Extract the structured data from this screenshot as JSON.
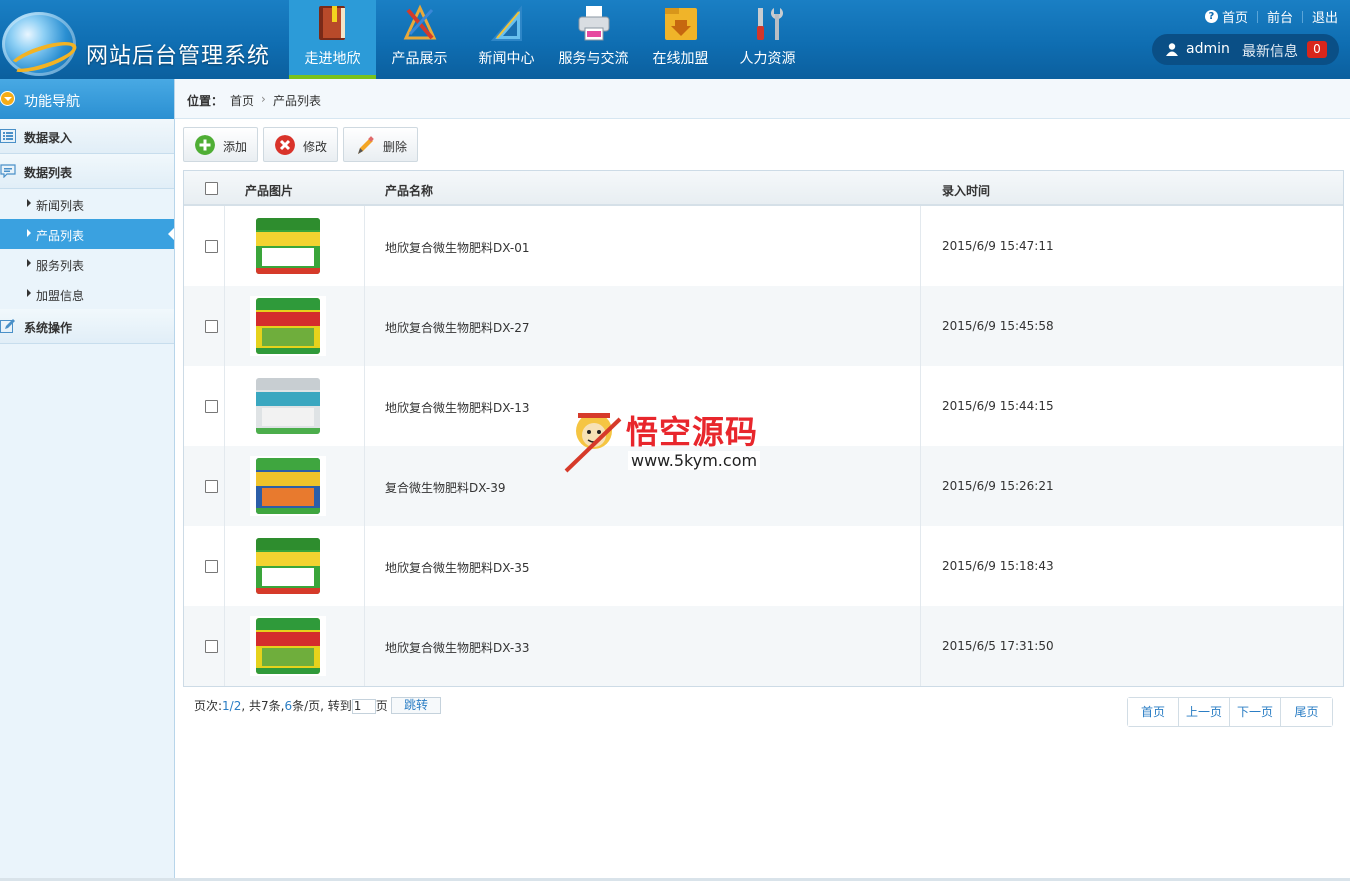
{
  "header": {
    "title": "网站后台管理系统",
    "nav": [
      {
        "label": "走进地欣",
        "icon": "book-icon",
        "active": true
      },
      {
        "label": "产品展示",
        "icon": "design-tools-icon",
        "active": false
      },
      {
        "label": "新闻中心",
        "icon": "ruler-icon",
        "active": false
      },
      {
        "label": "服务与交流",
        "icon": "printer-icon",
        "active": false
      },
      {
        "label": "在线加盟",
        "icon": "folder-download-icon",
        "active": false
      },
      {
        "label": "人力资源",
        "icon": "tools-icon",
        "active": false
      }
    ],
    "links": {
      "home": "首页",
      "front": "前台",
      "logout": "退出"
    },
    "user": {
      "name": "admin",
      "newest_label": "最新信息",
      "count": "0"
    }
  },
  "sidebar": {
    "title": "功能导航",
    "groups": [
      {
        "label": "数据录入",
        "icon": "list-icon"
      },
      {
        "label": "数据列表",
        "icon": "chat-icon"
      },
      {
        "label": "系统操作",
        "icon": "edit-icon"
      }
    ],
    "items": [
      {
        "label": "新闻列表",
        "active": false
      },
      {
        "label": "产品列表",
        "active": true
      },
      {
        "label": "服务列表",
        "active": false
      },
      {
        "label": "加盟信息",
        "active": false
      }
    ]
  },
  "breadcrumb": {
    "label": "位置：",
    "home": "首页",
    "current": "产品列表"
  },
  "toolbar": {
    "add": "添加",
    "edit": "修改",
    "delete": "删除"
  },
  "table": {
    "columns": [
      "产品图片",
      "产品名称",
      "录入时间"
    ],
    "rows": [
      {
        "name": "地欣复合微生物肥料DX-01",
        "time": "2015/6/9 15:47:11",
        "color": "#3aa53a"
      },
      {
        "name": "地欣复合微生物肥料DX-27",
        "time": "2015/6/9 15:45:58",
        "color": "#e6d21c"
      },
      {
        "name": "地欣复合微生物肥料DX-13",
        "time": "2015/6/9 15:44:15",
        "color": "#dfe3e5"
      },
      {
        "name": "复合微生物肥料DX-39",
        "time": "2015/6/9 15:26:21",
        "color": "#2c5ea8"
      },
      {
        "name": "地欣复合微生物肥料DX-35",
        "time": "2015/6/9 15:18:43",
        "color": "#3aa53a"
      },
      {
        "name": "地欣复合微生物肥料DX-33",
        "time": "2015/6/5 17:31:50",
        "color": "#e6d21c"
      }
    ]
  },
  "pager": {
    "prefix": "页次:",
    "current": "1/2",
    "mid1": ", 共",
    "total": "7",
    "mid2": "条,",
    "per": "6",
    "mid3": "条/页, 转到",
    "goto_value": "1",
    "suffix": "页",
    "jump": "跳转",
    "first": "首页",
    "prev": "上一页",
    "next": "下一页",
    "last": "尾页"
  },
  "watermark": {
    "title": "悟空源码",
    "url": "www.5kym.com"
  }
}
